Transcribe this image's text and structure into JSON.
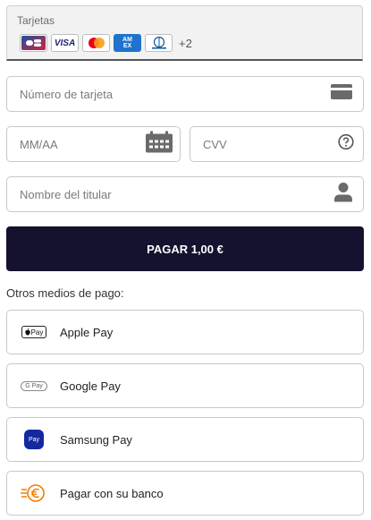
{
  "cards": {
    "label": "Tarjetas",
    "brands": [
      "cb-icon",
      "visa-icon",
      "mastercard-icon",
      "amex-icon",
      "diners-icon"
    ],
    "visa_text": "VISA",
    "amex_text": "AM EX",
    "more": "+2"
  },
  "card_form": {
    "number_placeholder": "Número de tarjeta",
    "expiry_placeholder": "MM/AA",
    "cvv_placeholder": "CVV",
    "holder_placeholder": "Nombre del titular"
  },
  "pay_button": "PAGAR 1,00 €",
  "other_methods": {
    "title": "Otros medios de pago:",
    "apple_logo_text": "Pay",
    "google_logo_text": "G Pay",
    "samsung_logo_text": "Pay",
    "items": [
      {
        "label": "Apple Pay",
        "icon": "apple-pay-icon"
      },
      {
        "label": "Google Pay",
        "icon": "google-pay-icon"
      },
      {
        "label": "Samsung Pay",
        "icon": "samsung-pay-icon"
      },
      {
        "label": "Pagar con su banco",
        "icon": "bank-euro-icon"
      }
    ]
  },
  "colors": {
    "pay_button_bg": "#14122e",
    "samsung_blue": "#1428a0",
    "bank_orange": "#f07d00"
  }
}
